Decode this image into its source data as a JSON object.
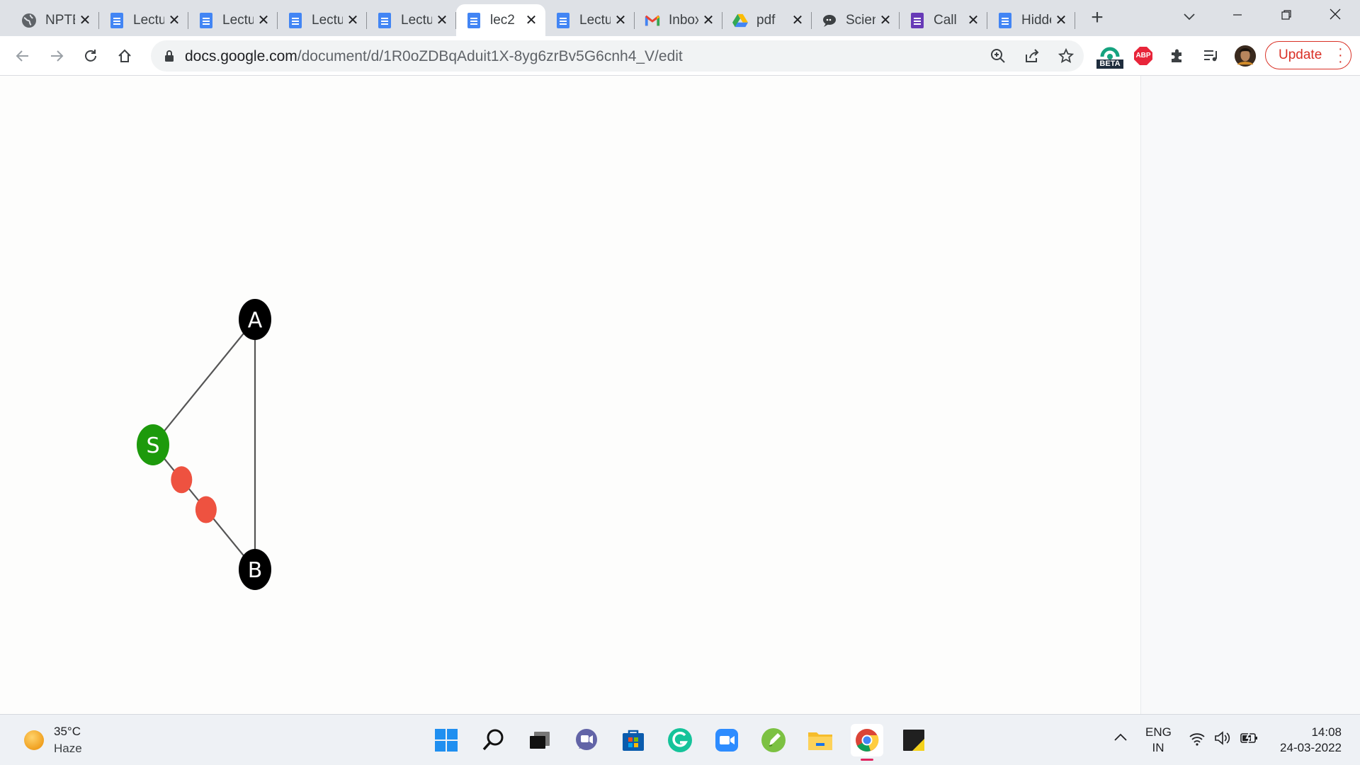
{
  "browser": {
    "tabs": [
      {
        "title": "NPTEL",
        "icon": "globe-icon",
        "active": false
      },
      {
        "title": "Lecture",
        "icon": "docs-icon",
        "active": false
      },
      {
        "title": "Lecture",
        "icon": "docs-icon",
        "active": false
      },
      {
        "title": "Lecture",
        "icon": "docs-icon",
        "active": false
      },
      {
        "title": "Lecture",
        "icon": "docs-icon",
        "active": false
      },
      {
        "title": "lec2",
        "icon": "docs-icon",
        "active": true
      },
      {
        "title": "Lecture",
        "icon": "docs-icon",
        "active": false
      },
      {
        "title": "Inbox",
        "icon": "gmail-icon",
        "active": false
      },
      {
        "title": "pdf",
        "icon": "drive-icon",
        "active": false
      },
      {
        "title": "Science",
        "icon": "chat-icon",
        "active": false
      },
      {
        "title": "Call",
        "icon": "forms-icon",
        "active": false
      },
      {
        "title": "Hidden",
        "icon": "docs-icon",
        "active": false
      }
    ],
    "url_domain": "docs.google.com",
    "url_path": "/document/d/1R0oZDBqAduit1X-8yg6zrBv5G6cnh4_V/edit",
    "update_label": "Update",
    "extension_badge": "BETA",
    "abp_label": "ABP"
  },
  "diagram": {
    "nodes": [
      {
        "id": "A",
        "label": "A",
        "color": "#000000"
      },
      {
        "id": "S",
        "label": "S",
        "color": "#1d9a0c"
      },
      {
        "id": "B",
        "label": "B",
        "color": "#000000"
      }
    ],
    "edges": [
      [
        "S",
        "A"
      ],
      [
        "A",
        "B"
      ],
      [
        "S",
        "B"
      ]
    ],
    "markers": [
      {
        "on_edge": [
          "S",
          "B"
        ],
        "count": 2,
        "color": "#ee5240"
      }
    ]
  },
  "taskbar": {
    "weather_temp": "35°C",
    "weather_condition": "Haze",
    "lang_top": "ENG",
    "lang_bottom": "IN",
    "time": "14:08",
    "date": "24-03-2022"
  }
}
